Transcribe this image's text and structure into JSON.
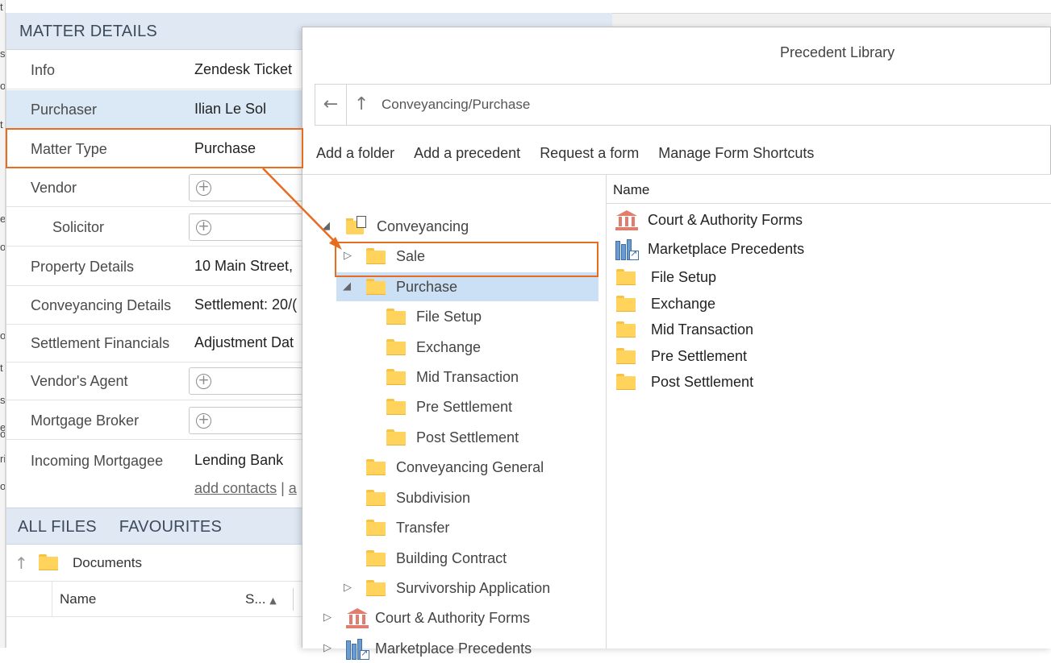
{
  "edge_glyphs": [
    "t",
    "s",
    "o",
    "t",
    "e",
    "o",
    "o",
    "t",
    "s",
    "e",
    "o",
    "ri",
    "o"
  ],
  "matter": {
    "header": "MATTER DETAILS",
    "rows": [
      {
        "label": "Info",
        "value": "Zendesk Ticket"
      },
      {
        "label": "Purchaser",
        "value": "Ilian Le Sol"
      },
      {
        "label": "Matter Type",
        "value": "Purchase"
      },
      {
        "label": "Vendor",
        "value": ""
      },
      {
        "label": "Solicitor",
        "value": ""
      },
      {
        "label": "Property Details",
        "value": "10 Main Street,"
      },
      {
        "label": "Conveyancing Details",
        "value": "Settlement: 20/("
      },
      {
        "label": "Settlement Financials",
        "value": "Adjustment Dat"
      },
      {
        "label": "Vendor's Agent",
        "value": ""
      },
      {
        "label": "Mortgage Broker",
        "value": ""
      },
      {
        "label": "Incoming Mortgagee",
        "value": "Lending Bank"
      }
    ],
    "add_contacts": "add contacts",
    "add_contacts_sep": "|",
    "add_contacts_tail": "a"
  },
  "files": {
    "tabs": [
      "ALL FILES",
      "FAVOURITES"
    ],
    "folder": "Documents",
    "columns": {
      "name": "Name",
      "size": "S..."
    }
  },
  "dialog": {
    "title": "Precedent Library",
    "path": "Conveyancing/Purchase",
    "toolbar": [
      "Add a folder",
      "Add a precedent",
      "Request a form",
      "Manage Form Shortcuts"
    ],
    "tree": [
      {
        "label": "Conveyancing",
        "expander": "◢",
        "icon": "folder-doc-icon"
      },
      {
        "label": "Sale",
        "expander": "▷",
        "icon": "folder-icon"
      },
      {
        "label": "Purchase",
        "expander": "◢",
        "icon": "folder-icon",
        "selected": true
      },
      {
        "label": "File Setup",
        "expander": "",
        "icon": "folder-icon"
      },
      {
        "label": "Exchange",
        "expander": "",
        "icon": "folder-icon"
      },
      {
        "label": "Mid Transaction",
        "expander": "",
        "icon": "folder-icon"
      },
      {
        "label": "Pre Settlement",
        "expander": "",
        "icon": "folder-icon"
      },
      {
        "label": "Post Settlement",
        "expander": "",
        "icon": "folder-icon"
      },
      {
        "label": "Conveyancing General",
        "expander": "",
        "icon": "folder-icon"
      },
      {
        "label": "Subdivision",
        "expander": "",
        "icon": "folder-icon"
      },
      {
        "label": "Transfer",
        "expander": "",
        "icon": "folder-icon"
      },
      {
        "label": "Building Contract",
        "expander": "",
        "icon": "folder-icon"
      },
      {
        "label": "Survivorship Application",
        "expander": "▷",
        "icon": "folder-icon"
      },
      {
        "label": "Court & Authority Forms",
        "expander": "▷",
        "icon": "court-icon"
      },
      {
        "label": "Marketplace Precedents",
        "expander": "▷",
        "icon": "marketplace-icon"
      }
    ],
    "list_header": "Name",
    "list": [
      {
        "label": "Court & Authority Forms",
        "icon": "court-icon"
      },
      {
        "label": "Marketplace Precedents",
        "icon": "marketplace-icon"
      },
      {
        "label": "File Setup",
        "icon": "folder-icon"
      },
      {
        "label": "Exchange",
        "icon": "folder-icon"
      },
      {
        "label": "Mid Transaction",
        "icon": "folder-icon"
      },
      {
        "label": "Pre Settlement",
        "icon": "folder-icon"
      },
      {
        "label": "Post Settlement",
        "icon": "folder-icon"
      }
    ]
  },
  "colors": {
    "highlight": "#e86c1f",
    "selection": "#cce0f5",
    "header_bg": "#dfe8f3"
  }
}
